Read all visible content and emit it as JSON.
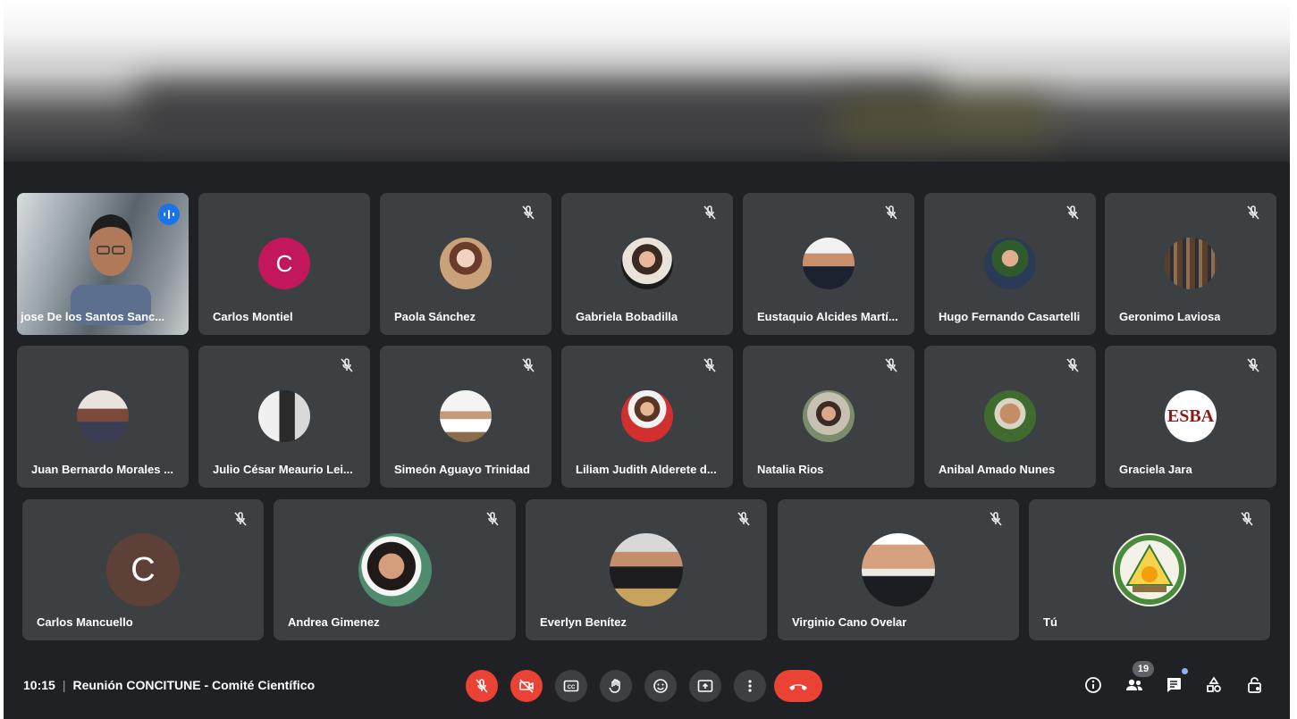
{
  "meeting": {
    "time": "10:15",
    "separator": "|",
    "title": "Reunión CONCITUNE - Comité Científico",
    "participant_count": "19"
  },
  "icons": {
    "muted": "mic-off-icon",
    "speaking": "audio-level-icon",
    "mic": "mic-off-icon",
    "camera": "videocam-off-icon",
    "captions": "closed-captions-icon",
    "hand": "raise-hand-icon",
    "reactions": "emoji-icon",
    "present": "present-screen-icon",
    "more": "more-vert-icon",
    "leave": "call-end-icon",
    "info": "info-icon",
    "people": "people-icon",
    "chat": "chat-icon",
    "activities": "activities-icon",
    "host_controls": "lock-person-icon"
  },
  "colors": {
    "meet_bg": "#202124",
    "tile_bg": "#3c4043",
    "red": "#ea4335",
    "blue_accent": "#1a73e8"
  },
  "participants": [
    {
      "name": "jose De los Santos Sanc...",
      "type": "video",
      "speaking": true
    },
    {
      "name": "Carlos Montiel",
      "type": "letter",
      "letter": "C",
      "color": "#c2185b"
    },
    {
      "name": "Paola Sánchez",
      "type": "photo",
      "muted": true
    },
    {
      "name": "Gabriela Bobadilla",
      "type": "photo",
      "muted": true
    },
    {
      "name": "Eustaquio Alcides Martí...",
      "type": "photo",
      "muted": true
    },
    {
      "name": "Hugo Fernando Casartelli",
      "type": "photo",
      "muted": true
    },
    {
      "name": "Geronimo Laviosa",
      "type": "photo",
      "muted": true
    },
    {
      "name": "Juan Bernardo Morales ...",
      "type": "photo"
    },
    {
      "name": "Julio César Meaurio Lei...",
      "type": "photo",
      "muted": true
    },
    {
      "name": "Simeón Aguayo Trinidad",
      "type": "photo",
      "muted": true
    },
    {
      "name": "Liliam Judith Alderete d...",
      "type": "photo",
      "muted": true
    },
    {
      "name": "Natalia Rios",
      "type": "photo",
      "muted": true
    },
    {
      "name": "Anibal Amado Nunes",
      "type": "photo",
      "muted": true
    },
    {
      "name": "Graciela Jara",
      "type": "logo",
      "logo_text": "ESBA",
      "muted": true
    },
    {
      "name": "Carlos Mancuello",
      "type": "letter",
      "letter": "C",
      "color": "#5d4037",
      "muted": true
    },
    {
      "name": "Andrea Gimenez",
      "type": "photo",
      "muted": true
    },
    {
      "name": "Everlyn Benítez",
      "type": "photo",
      "muted": true
    },
    {
      "name": "Virginio Cano Ovelar",
      "type": "photo",
      "muted": true
    },
    {
      "name": "Tú",
      "type": "emblem",
      "muted": true
    }
  ]
}
